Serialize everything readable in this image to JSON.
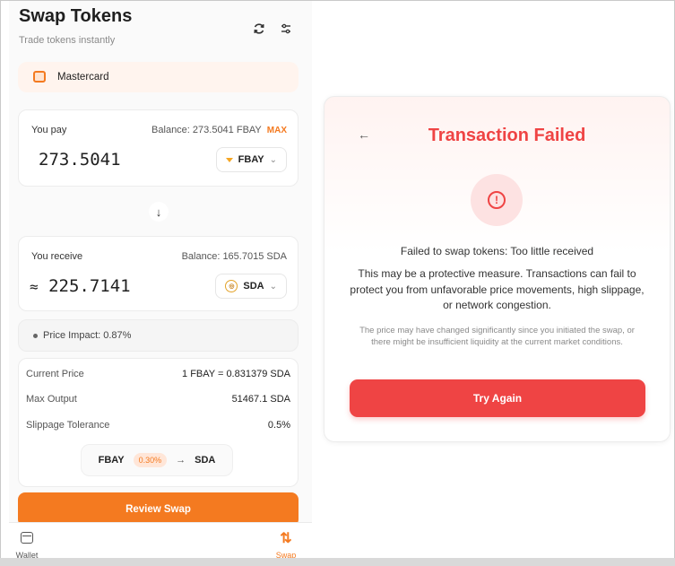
{
  "swap": {
    "title": "Swap Tokens",
    "subtitle": "Trade tokens instantly",
    "refresh_icon": "refresh-icon",
    "settings_icon": "sliders-icon",
    "payment_method": "Mastercard",
    "pay": {
      "label": "You pay",
      "balance": "Balance: 273.5041 FBAY",
      "max_label": "MAX",
      "amount": "273.5041",
      "token": "FBAY"
    },
    "receive": {
      "label": "You receive",
      "balance": "Balance: 165.7015 SDA",
      "approx": "≈",
      "amount": "225.7141",
      "token": "SDA"
    },
    "price_impact": "Price Impact: 0.87%",
    "details": {
      "current_price_label": "Current Price",
      "current_price_value": "1 FBAY = 0.831379 SDA",
      "max_output_label": "Max Output",
      "max_output_value": "51467.1 SDA",
      "slippage_label": "Slippage Tolerance",
      "slippage_value": "0.5%"
    },
    "route": {
      "from": "FBAY",
      "fee": "0.30%",
      "to": "SDA"
    },
    "review_button": "Review Swap"
  },
  "nav": {
    "wallet": "Wallet",
    "swap": "Swap"
  },
  "modal": {
    "title": "Transaction Failed",
    "error": "Failed to swap tokens: Too little received",
    "description": "This may be a protective measure. Transactions can fail to protect you from unfavorable price movements, high slippage, or network congestion.",
    "note": "The price may have changed significantly since you initiated the swap, or there might be insufficient liquidity at the current market conditions.",
    "button": "Try Again"
  },
  "colors": {
    "accent": "#f47a20",
    "error": "#ef4444"
  }
}
